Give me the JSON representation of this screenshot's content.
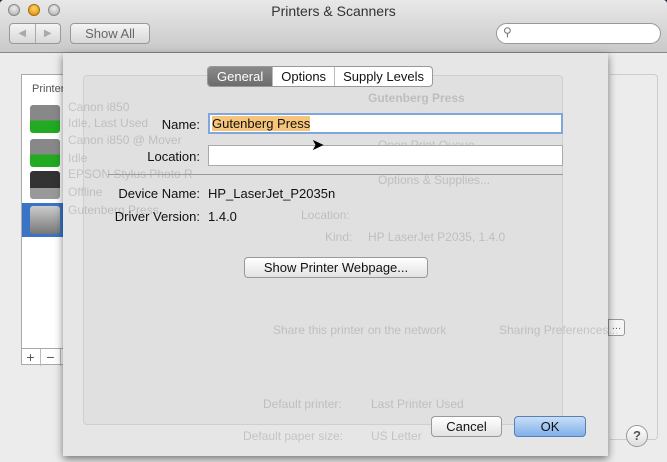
{
  "window": {
    "title": "Printers & Scanners",
    "show_all": "Show All",
    "back": "◀",
    "forward": "▶",
    "search_placeholder": ""
  },
  "background": {
    "list_header": "Printers",
    "printers": [
      {
        "name": "Canon i850",
        "status": "Idle, Last Used"
      },
      {
        "name": "Canon i850 @ Mover",
        "status": "Idle"
      },
      {
        "name": "EPSON Stylus Photo R",
        "status": "Offline"
      },
      {
        "name": "Gutenberg Press",
        "status": ""
      }
    ],
    "detail_title": "Gutenberg Press",
    "open_queue": "Open Print Queue...",
    "options_supplies": "Options & Supplies...",
    "location_label": "Location:",
    "kind_label": "Kind:",
    "kind_value": "HP LaserJet P2035, 1.4.0",
    "share_label": "Share this printer on the network",
    "sharing_prefs": "Sharing Preferences...",
    "default_printer_label": "Default printer:",
    "default_printer_value": "Last Printer Used",
    "default_paper_label": "Default paper size:",
    "default_paper_value": "US Letter",
    "add": "+",
    "remove": "−",
    "help": "?"
  },
  "sheet": {
    "tabs": [
      {
        "label": "General",
        "active": true
      },
      {
        "label": "Options"
      },
      {
        "label": "Supply Levels"
      }
    ],
    "name_label": "Name:",
    "name_value": "Gutenberg Press",
    "location_label": "Location:",
    "location_value": "",
    "device_name_label": "Device Name:",
    "device_name_value": "HP_LaserJet_P2035n",
    "driver_version_label": "Driver Version:",
    "driver_version_value": "1.4.0",
    "webpage_button": "Show Printer Webpage...",
    "cancel": "Cancel",
    "ok": "OK"
  }
}
